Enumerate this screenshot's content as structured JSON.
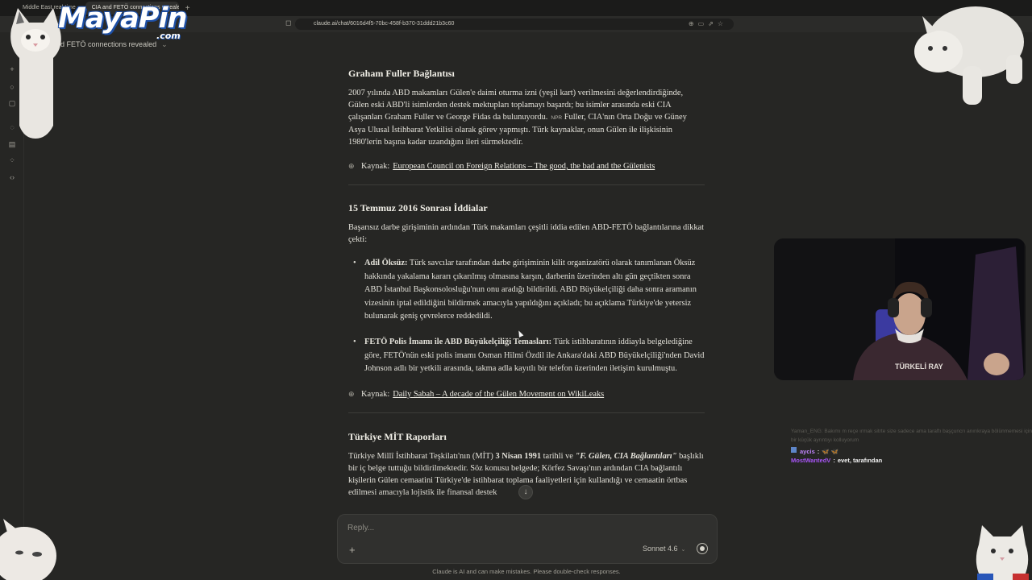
{
  "browser": {
    "tabs": [
      {
        "label": "Middle East real-time"
      },
      {
        "label": "CIA and FETÖ connections revealed"
      }
    ],
    "new_tab_symbol": "+",
    "url": "claude.ai/chat/6016d4f5-70bc-458f-b370-31ddd21b3c60"
  },
  "overlay": {
    "logo_text": "MayaPin",
    "logo_suffix": ".com"
  },
  "conversation": {
    "title": "CIA and FETÖ connections revealed"
  },
  "sections": {
    "fuller": {
      "heading": "Graham Fuller Bağlantısı",
      "paragraph": "2007 yılında ABD makamları Gülen'e daimi oturma izni (yeşil kart) verilmesini değerlendirdiğinde, Gülen eski ABD'li isimlerden destek mektupları toplamayı başardı; bu isimler arasında eski CIA çalışanları Graham Fuller ve George Fidas da bulunuyordu.",
      "paragraph_badge": "NPR",
      "paragraph_rest": "Fuller, CIA'nın Orta Doğu ve Güney Asya Ulusal İstihbarat Yetkilisi olarak görev yapmıştı. Türk kaynaklar, onun Gülen ile ilişkisinin 1980'lerin başına kadar uzandığını ileri sürmektedir.",
      "source_label": "Kaynak:",
      "source_link": "European Council on Foreign Relations – The good, the bad and the Gülenists"
    },
    "july15": {
      "heading": "15 Temmuz 2016 Sonrası İddialar",
      "intro": "Başarısız darbe girişiminin ardından Türk makamları çeşitli iddia edilen ABD-FETÖ bağlantılarına dikkat çekti:",
      "bullets": [
        {
          "title": "Adil Öksüz:",
          "text": "Türk savcılar tarafından darbe girişiminin kilit organizatörü olarak tanımlanan Öksüz hakkında yakalama kararı çıkarılmış olmasına karşın, darbenin üzerinden altı gün geçtikten sonra ABD İstanbul Başkonsolosluğu'nun onu aradığı bildirildi. ABD Büyükelçiliği daha sonra aramanın vizesinin iptal edildiğini bildirmek amacıyla yapıldığını açıkladı; bu açıklama Türkiye'de yetersiz bulunarak geniş çevrelerce reddedildi."
        },
        {
          "title": "FETÖ Polis İmamı ile ABD Büyükelçiliği Temasları:",
          "text": "Türk istihbaratının iddiayla belgelediğine göre, FETÖ'nün eski polis imamı Osman Hilmi Özdil ile Ankara'daki ABD Büyükelçiliği'nden David Johnson adlı bir yetkili arasında, takma adla kayıtlı bir telefon üzerinden iletişim kurulmuştu."
        }
      ],
      "source_label": "Kaynak:",
      "source_link": "Daily Sabah – A decade of the Gülen Movement on WikiLeaks"
    },
    "mit": {
      "heading": "Türkiye MİT Raporları",
      "p_a": "Türkiye Millî İstihbarat Teşkilatı'nın (MİT) ",
      "p_date": "3 Nisan 1991",
      "p_b": " tarihli ve ",
      "p_title": "\"F. Gülen, CIA Bağlantıları\"",
      "p_c": " başlıklı bir iç belge tuttuğu bildirilmektedir. Söz konusu belgede; Körfez Savaşı'nın ardından CIA bağlantılı kişilerin Gülen cemaatini Türkiye'de istihbarat toplama faaliyetleri için kullandığı ve cemaatin örtbas edilmesi amacıyla lojistik ile finansal destek"
    }
  },
  "composer": {
    "placeholder": "Reply...",
    "plus": "+",
    "model": "Sonnet 4.6",
    "scroll_down": "↓"
  },
  "disclaimer": "Claude is AI and can make mistakes. Please double-check responses.",
  "chat_overlay": {
    "faded": "Yaman_ENG: Bakımı m reçe ırmak sitrte size sadece ama taraftı başçuncrı anırıkraya bölünmemesi için bir küçük ayrıntıyı kolluyorum",
    "messages": [
      {
        "user": "aycis",
        "text": "🦋 🦋"
      },
      {
        "user": "MostWantedV",
        "text": "evet, tarafından"
      }
    ]
  }
}
